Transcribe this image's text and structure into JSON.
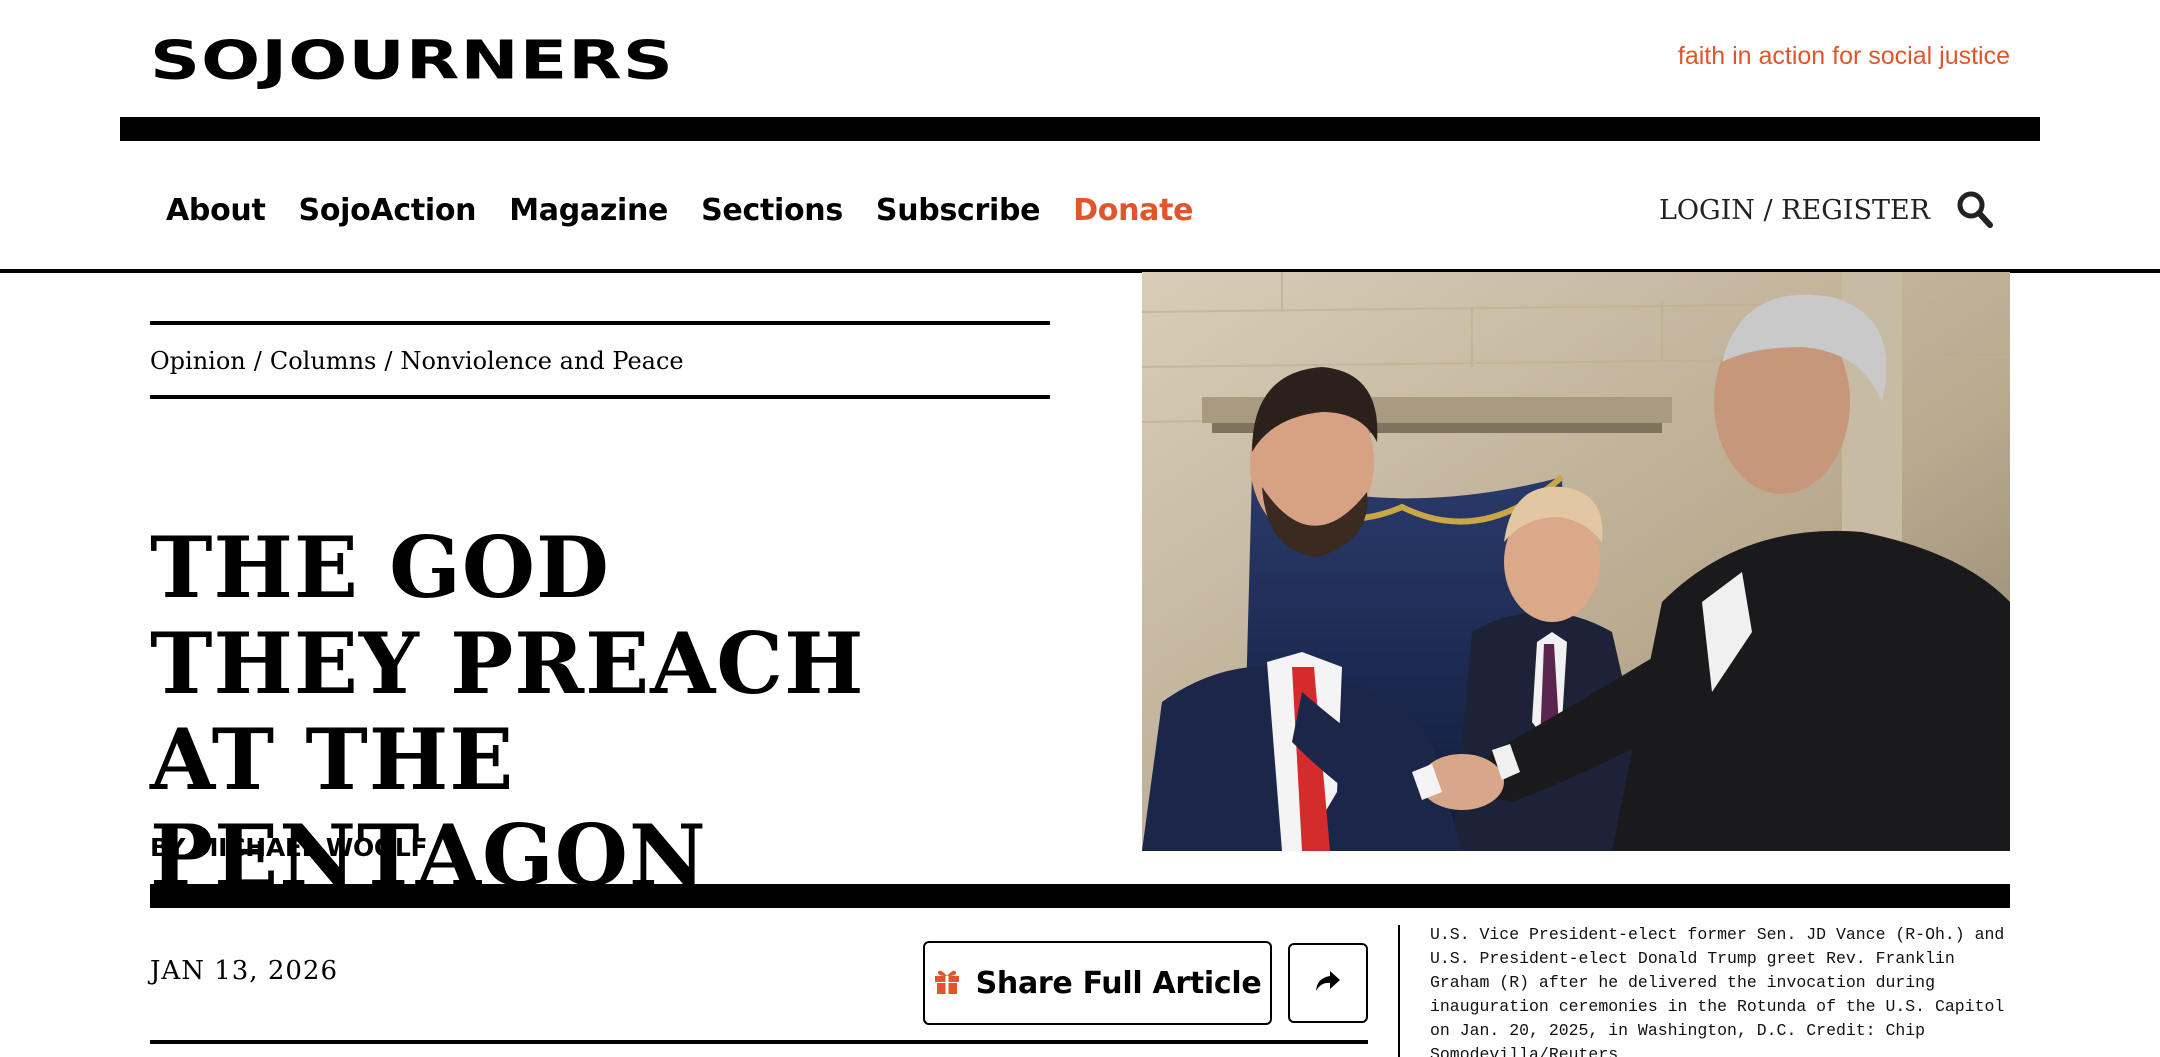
{
  "header": {
    "logo_text": "SOJOURNERS",
    "tagline": "faith in action for social justice"
  },
  "nav": {
    "items": [
      {
        "label": "About"
      },
      {
        "label": "SojoAction"
      },
      {
        "label": "Magazine"
      },
      {
        "label": "Sections"
      },
      {
        "label": "Subscribe"
      },
      {
        "label": "Donate"
      }
    ],
    "auth_label": "LOGIN / REGISTER",
    "search_icon": "search-icon"
  },
  "article": {
    "breadcrumb": [
      "Opinion",
      "/",
      "Columns",
      "/",
      "Nonviolence and Peace"
    ],
    "headline": "THE GOD THEY PREACH AT THE PENTAGON",
    "byline": "BY MICHAEL WOOLF",
    "date": "JAN 13, 2026",
    "share_label": "Share Full Article",
    "share_icon": "gift-icon",
    "forward_icon": "share-forward-icon",
    "caption": "U.S. Vice President-elect former Sen. JD Vance (R-Oh.) and U.S. President-elect Donald Trump greet Rev. Franklin Graham (R) after he delivered the invocation during inauguration ceremonies in the Rotunda of the U.S. Capitol on Jan. 20, 2025, in Washington, D.C. Credit: Chip Somodevilla/Reuters"
  },
  "colors": {
    "accent": "#e0552b",
    "text": "#000000",
    "background": "#ffffff"
  }
}
